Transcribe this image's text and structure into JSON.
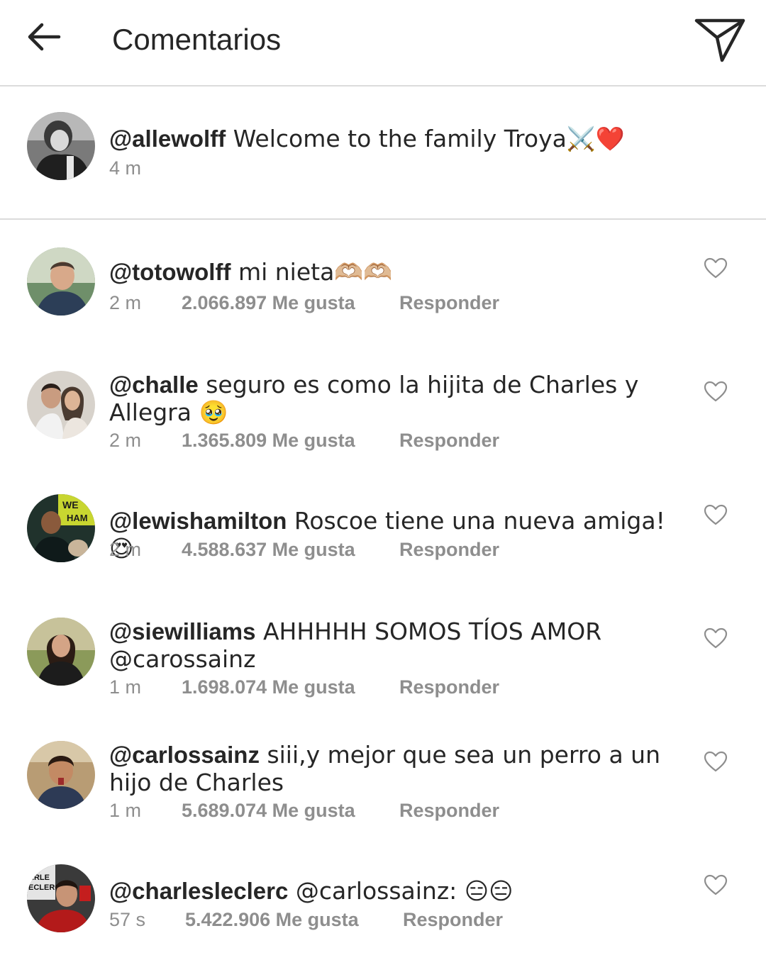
{
  "header": {
    "title": "Comentarios",
    "back_icon": "arrow-left-icon",
    "share_icon": "paper-plane-icon"
  },
  "caption": {
    "username": "@allewolff",
    "text": " Welcome to the family Troya⚔️❤️",
    "time": "4 m"
  },
  "comments": [
    {
      "username": "@totowolff",
      "text": " mi nieta🫶🏼🫶🏼",
      "time": "2 m",
      "likes": "2.066.897 Me gusta",
      "reply": "Responder"
    },
    {
      "username": "@challe",
      "text": " seguro es como la hijita de Charles y Allegra 🥹",
      "time": "2 m",
      "likes": "1.365.809 Me gusta",
      "reply": "Responder"
    },
    {
      "username": "@lewishamilton",
      "text": " Roscoe tiene una nueva amiga!😍",
      "time": "2 m",
      "likes": "4.588.637 Me gusta",
      "reply": "Responder"
    },
    {
      "username": "@siewilliams",
      "text": " AHHHHH SOMOS TÍOS AMOR @carossainz",
      "time": "1 m",
      "likes": "1.698.074 Me gusta",
      "reply": "Responder"
    },
    {
      "username": "@carlossainz",
      "text": " siii,y mejor que sea un perro a un hijo de Charles",
      "time": "1 m",
      "likes": "5.689.074 Me gusta",
      "reply": "Responder"
    },
    {
      "username": "@charlesleclerc",
      "text": " @carlossainz: 😑😑",
      "time": "57 s",
      "likes": "5.422.906 Me gusta",
      "reply": "Responder"
    }
  ],
  "colors": {
    "text": "#262626",
    "secondary": "#8e8e8e",
    "divider": "#dbdbdb"
  }
}
